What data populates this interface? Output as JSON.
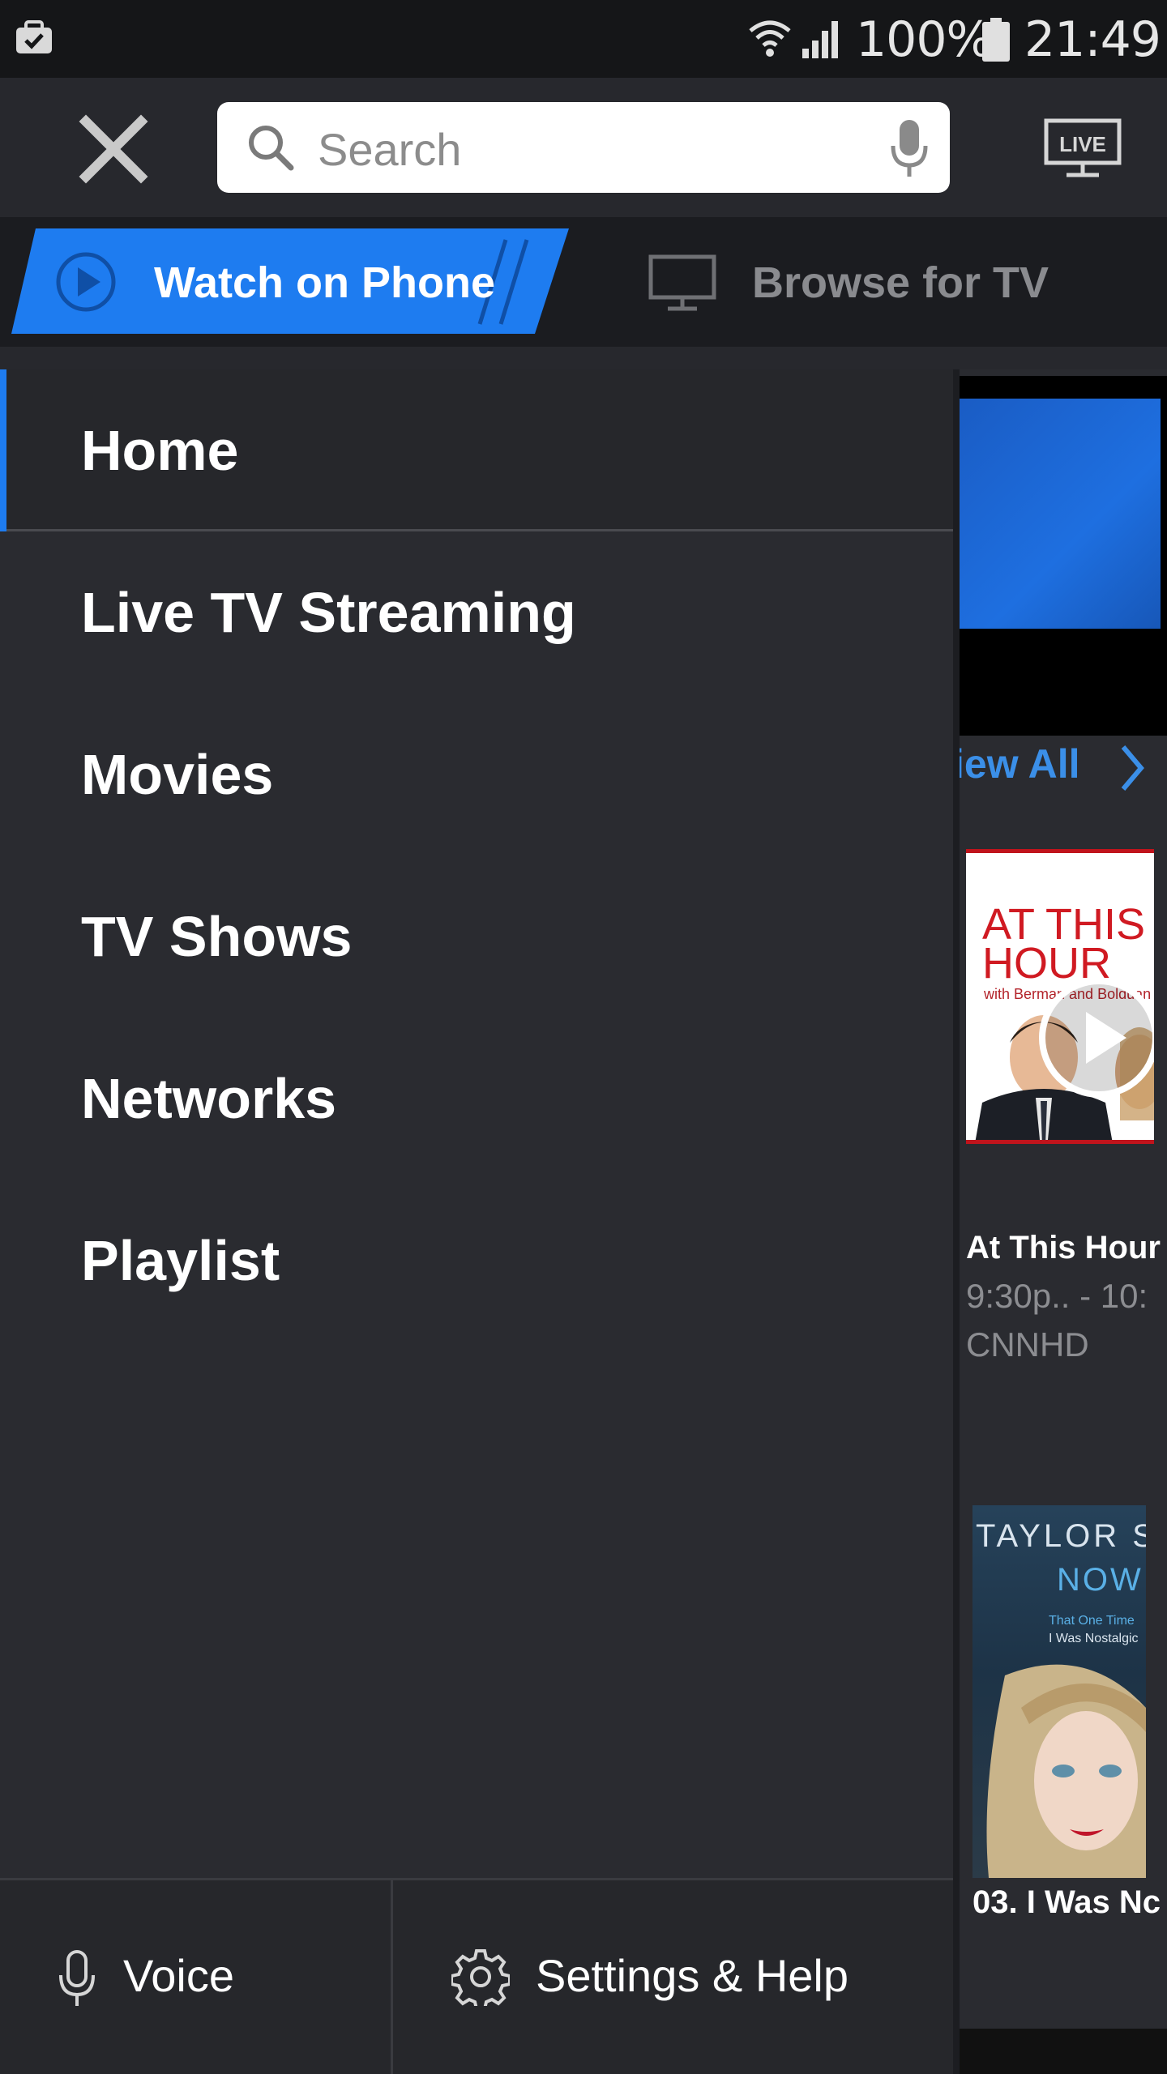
{
  "status_bar": {
    "battery_percent": "100%",
    "time": "21:49"
  },
  "header": {
    "search_placeholder": "Search",
    "tabs": [
      {
        "label": "Watch on Phone",
        "active": true
      },
      {
        "label": "Browse for TV",
        "active": false
      }
    ],
    "live_label": "LIVE"
  },
  "menu": {
    "items": [
      {
        "label": "Home",
        "active": true
      },
      {
        "label": "Live TV Streaming"
      },
      {
        "label": "Movies"
      },
      {
        "label": "TV Shows"
      },
      {
        "label": "Networks"
      },
      {
        "label": "Playlist"
      }
    ]
  },
  "footer": {
    "voice_label": "Voice",
    "settings_label": "Settings & Help"
  },
  "background": {
    "view_all_label": "iew All",
    "show1": {
      "thumb_title_line1": "AT THIS",
      "thumb_title_line2": "HOUR",
      "thumb_subtitle": "with Berman and Bolduan",
      "title": "At This Hour",
      "time": "9:30p.. - 10:",
      "network": "CNNHD"
    },
    "show2": {
      "thumb_line1": "TAYLOR S",
      "thumb_line2": "NOW",
      "thumb_line3": "That One Time",
      "thumb_line4": "I Was Nostalgic",
      "title": "03. I Was Nc"
    }
  },
  "colors": {
    "accent": "#1e7cf0",
    "drawer_bg": "#2a2b30",
    "header_bg": "#27282d",
    "link_blue": "#3b8fe8"
  }
}
